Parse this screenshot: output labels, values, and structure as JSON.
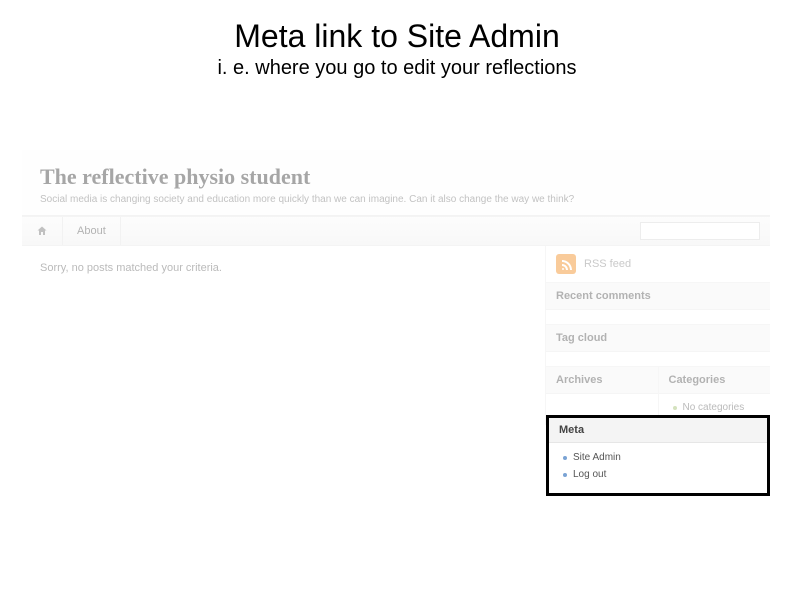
{
  "slide": {
    "title": "Meta link to Site Admin",
    "subtitle": "i. e. where you go to edit your reflections"
  },
  "site": {
    "title": "The reflective physio student",
    "tagline": "Social media is changing society and education more quickly than we can imagine. Can it also change the way we think?"
  },
  "nav": {
    "about": "About"
  },
  "main": {
    "no_posts": "Sorry, no posts matched your criteria."
  },
  "sidebar": {
    "rss_label": "RSS feed",
    "recent_comments": "Recent comments",
    "tag_cloud": "Tag cloud",
    "archives": "Archives",
    "categories": "Categories",
    "no_categories": "No categories"
  },
  "meta": {
    "heading": "Meta",
    "site_admin": "Site Admin",
    "log_out": "Log out"
  }
}
